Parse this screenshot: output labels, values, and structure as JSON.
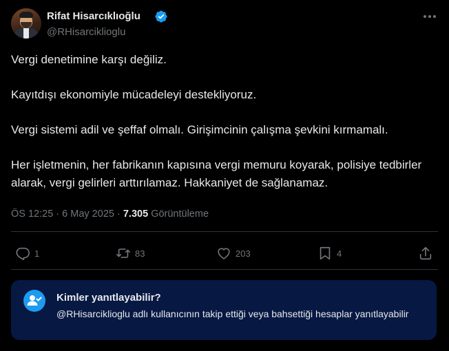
{
  "author": {
    "name": "Rifat Hisarcıklıoğlu",
    "handle": "@RHisarciklioglu",
    "verified": true,
    "avatar_icon": "profile-photo"
  },
  "tweet": {
    "paragraphs": [
      "Vergi denetimine karşı değiliz.",
      "Kayıtdışı ekonomiyle mücadeleyi destekliyoruz.",
      "Vergi sistemi adil ve şeffaf olmalı. Girişimcinin çalışma şevkini kırmamalı.",
      "Her işletmenin, her fabrikanın kapısına vergi memuru koyarak, polisiye tedbirler alarak, vergi gelirleri arttırılamaz. Hakkaniyet de sağlanamaz."
    ],
    "time": "ÖS 12:25",
    "separator": "·",
    "date": "6 May 2025",
    "views_count": "7.305",
    "views_label": "Görüntüleme"
  },
  "actions": {
    "reply_count": "1",
    "retweet_count": "83",
    "like_count": "203",
    "bookmark_count": "4"
  },
  "reply_restriction": {
    "title": "Kimler yanıtlayabilir?",
    "description": "@RHisarciklioglu adlı kullanıcının takip ettiği veya bahsettiği hesaplar yanıtlayabilir"
  },
  "colors": {
    "background": "#000000",
    "text": "#e7e9ea",
    "secondary_text": "#71767b",
    "accent": "#1d9bf0",
    "card_background": "#071843",
    "divider": "#2f3336"
  }
}
